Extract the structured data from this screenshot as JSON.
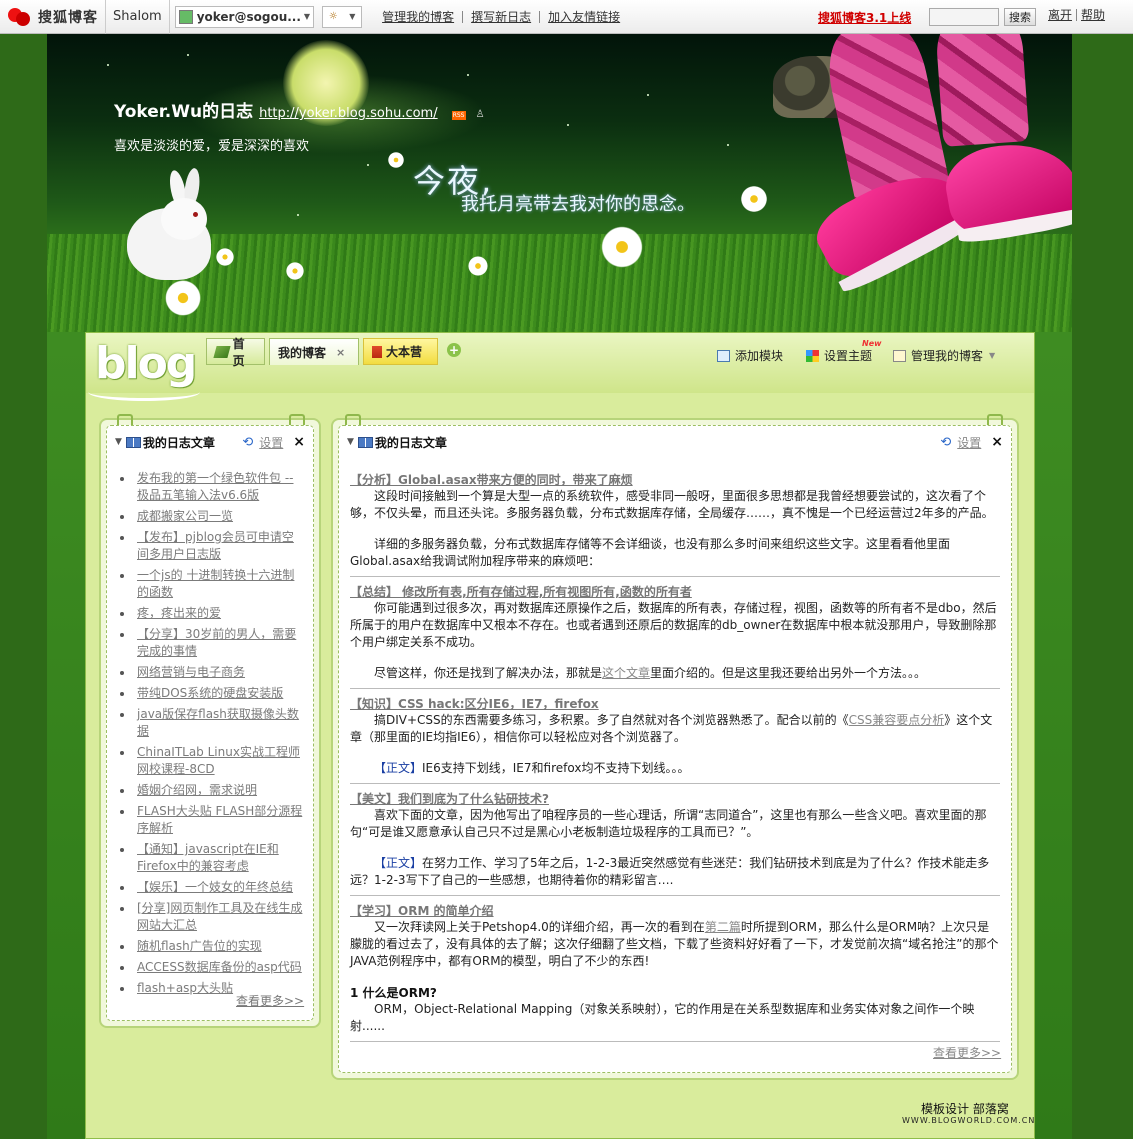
{
  "topbar": {
    "brand": "搜狐博客",
    "user_name": "Shalom",
    "account": "yoker@sogou...",
    "links": [
      "管理我的博客",
      "撰写新日志",
      "加入友情链接"
    ],
    "promo": "搜狐博客3.1上线",
    "search_button": "搜索",
    "right_links": [
      "离开",
      "帮助"
    ]
  },
  "header": {
    "blog_name": "Yoker.Wu的日志",
    "blog_url": "http://yoker.blog.sohu.com/",
    "subtitle": "喜欢是淡淡的爱，爱是深深的喜欢",
    "tagline_big": "今夜,",
    "tagline_small": "我托月亮带去我对你的思念。"
  },
  "nav": {
    "logo_text": "blog",
    "tabs": [
      "首页",
      "我的博客",
      "大本营"
    ],
    "tab_close": "×",
    "add_tab": "+",
    "tools": [
      "添加模块",
      "设置主题",
      "管理我的博客"
    ],
    "new_badge": "New"
  },
  "left_module": {
    "title": "我的日志文章",
    "settings_label": "设置",
    "close": "×",
    "items": [
      "发布我的第一个绿色软件包 --极品五笔输入法v6.6版",
      "成都搬家公司一览",
      "【发布】pjblog会员可申请空间多用户日志版",
      "一个js的 十进制转换十六进制的函数",
      "疼，疼出来的爱",
      "【分享】30岁前的男人，需要完成的事情",
      "网络营销与电子商务",
      "带纯DOS系统的硬盘安装版",
      "java版保存flash获取摄像头数据",
      "ChinaITLab Linux实战工程师网校课程-8CD",
      "婚姻介绍网，需求说明",
      "FLASH大头贴 FLASH部分源程序解析",
      "【通知】javascript在IE和Firefox中的兼容考虑",
      "【娱乐】一个妓女的年终总结",
      "[分享]网页制作工具及在线生成网站大汇总",
      "随机flash广告位的实现",
      "ACCESS数据库备份的asp代码",
      "flash+asp大头贴"
    ],
    "more": "查看更多>>"
  },
  "main_module": {
    "title": "我的日志文章",
    "settings_label": "设置",
    "close": "×",
    "articles": [
      {
        "title": "【分析】Global.asax带来方便的同时，带来了麻烦",
        "paragraphs": [
          "这段时间接触到一个算是大型一点的系统软件，感受非同一般呀，里面很多思想都是我曾经想要尝试的，这次看了个够，不仅头晕，而且还头诧。多服务器负载，分布式数据库存储，全局缓存……，真不愧是一个已经运营过2年多的产品。",
          "详细的多服务器负载，分布式数据库存储等不会详细谈，也没有那么多时间来组织这些文字。这里看看他里面Global.asax给我调试附加程序带来的麻烦吧："
        ]
      },
      {
        "title": "【总结】 修改所有表,所有存储过程,所有视图所有,函数的所有者",
        "paragraphs": [
          "你可能遇到过很多次，再对数据库还原操作之后，数据库的所有表，存储过程，视图，函数等的所有者不是dbo，然后所属于的用户在数据库中又根本不存在。也或者遇到还原后的数据库的db_owner在数据库中根本就没那用户，导致删除那个用户绑定关系不成功。",
          "尽管这样，你还是找到了解决办法，那就是|这个文章|里面介绍的。但是这里我还要给出另外一个方法。。。"
        ]
      },
      {
        "title": "【知识】CSS hack:区分IE6，IE7，firefox",
        "paragraphs": [
          "搞DIV+CSS的东西需要多练习，多积累。多了自然就对各个浏览器熟悉了。配合以前的《|CSS兼容要点分析|》这个文章（那里面的IE均指IE6），相信你可以轻松应对各个浏览器了。",
          "【正文】IE6支持下划线，IE7和firefox均不支持下划线。。。"
        ]
      },
      {
        "title": "【美文】我们到底为了什么钻研技术?",
        "paragraphs": [
          "喜欢下面的文章，因为他写出了咱程序员的一些心理话，所谓“志同道合”，这里也有那么一些含义吧。喜欢里面的那句“可是谁又愿意承认自己只不过是黑心小老板制造垃圾程序的工具而已？”。",
          "【正文】在努力工作、学习了5年之后，1-2-3最近突然感觉有些迷茫：我们钻研技术到底是为了什么？作技术能走多远？1-2-3写下了自己的一些感想，也期待着你的精彩留言…."
        ]
      },
      {
        "title": "【学习】ORM 的简单介绍",
        "paragraphs": [
          "又一次拜读网上关于Petshop4.0的详细介绍，再一次的看到在|第二篇|时所提到ORM，那么什么是ORM呐？上次只是朦胧的看过去了，没有具体的去了解；这次仔细翻了些文档，下载了些资料好好看了一下，才发觉前次搞“域名抢注”的那个JAVA范例程序中，都有ORM的模型，明白了不少的东西!",
          "1 什么是ORM?",
          "ORM，Object-Relational Mapping（对象关系映射），它的作用是在关系型数据库和业务实体对象之间作一个映射......"
        ]
      }
    ],
    "more": "查看更多>>"
  },
  "footer": {
    "credit": "模板设计 部落窝",
    "url": "WWW.BLOGWORLD.COM.CN"
  }
}
